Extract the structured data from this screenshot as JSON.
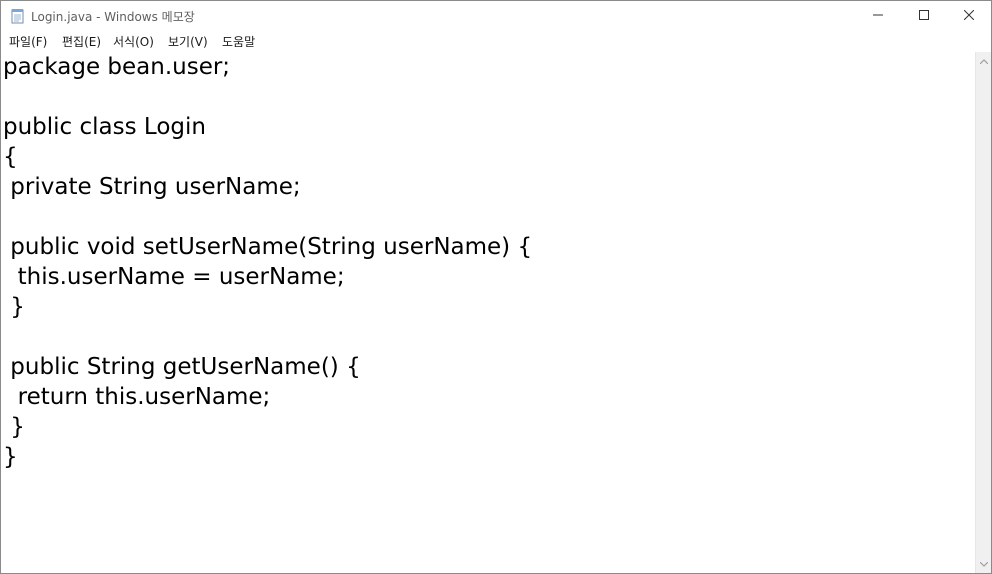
{
  "window": {
    "title": "Login.java - Windows 메모장",
    "icon": "notepad-icon"
  },
  "title_buttons": {
    "minimize": "minimize-icon",
    "maximize": "maximize-icon",
    "close": "close-icon"
  },
  "menu": {
    "items": [
      {
        "label": "파일(F)"
      },
      {
        "label": "편집(E)"
      },
      {
        "label": "서식(O)"
      },
      {
        "label": "보기(V)"
      },
      {
        "label": "도움말"
      }
    ]
  },
  "editor": {
    "lines": [
      "package bean.user;",
      "",
      "public class Login",
      "{",
      " private String userName;",
      "",
      " public void setUserName(String userName) {",
      "  this.userName = userName;",
      " }",
      "",
      " public String getUserName() {",
      "  return this.userName;",
      " }",
      "}"
    ]
  },
  "scrollbar": {
    "up": "scroll-up-arrow-icon",
    "down": "scroll-down-arrow-icon"
  }
}
